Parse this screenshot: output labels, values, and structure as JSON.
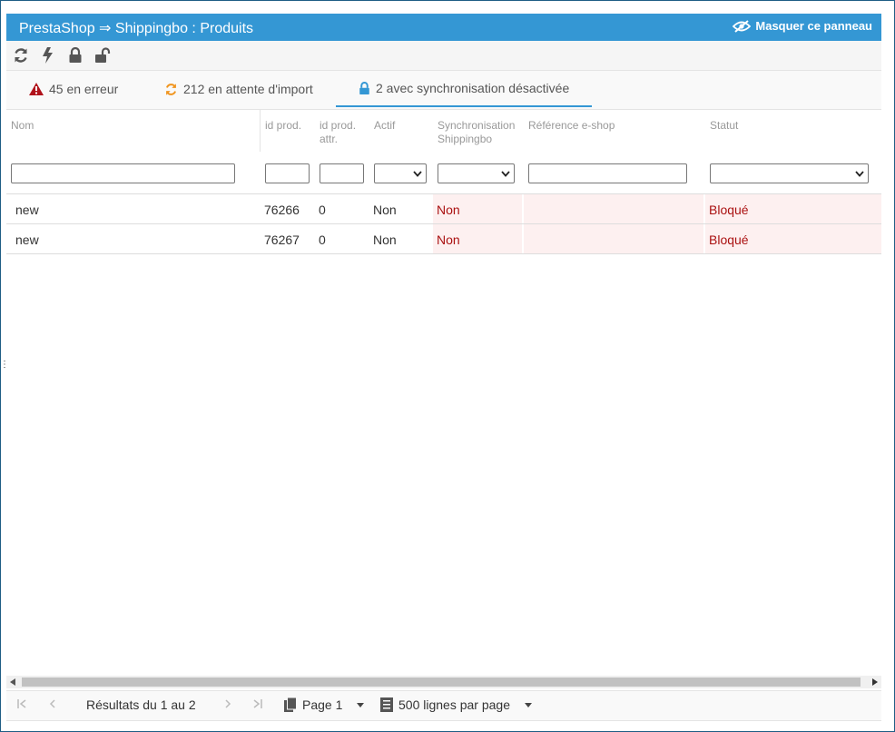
{
  "header": {
    "title": "PrestaShop ⇒ Shippingbo : Produits",
    "hide_label": "Masquer ce panneau"
  },
  "toolbar": {
    "icons": [
      "refresh-icon",
      "bolt-icon",
      "lock-icon",
      "unlock-icon"
    ]
  },
  "tabs": [
    {
      "label": "45 en erreur",
      "icon": "warning-icon",
      "color": "#b0121b"
    },
    {
      "label": "212 en attente d'import",
      "icon": "refresh-icon",
      "color": "#f0951f"
    },
    {
      "label": "2 avec synchronisation désactivée",
      "icon": "lock-icon",
      "color": "#3497d4",
      "active": true
    }
  ],
  "columns": {
    "nom": "Nom",
    "id_prod": "id prod.",
    "id_attr_1": "id prod.",
    "id_attr_2": "attr.",
    "actif": "Actif",
    "sync_1": "Synchronisation",
    "sync_2": "Shippingbo",
    "ref": "Référence e-shop",
    "statut": "Statut"
  },
  "rows": [
    {
      "nom": "new",
      "id_prod": "76266",
      "id_attr": "0",
      "actif": "Non",
      "sync": "Non",
      "ref": "",
      "statut": "Bloqué"
    },
    {
      "nom": "new",
      "id_prod": "76267",
      "id_attr": "0",
      "actif": "Non",
      "sync": "Non",
      "ref": "",
      "statut": "Bloqué"
    }
  ],
  "pager": {
    "results": "Résultats du 1 au 2",
    "page": "Page 1",
    "per_page": "500 lignes par page"
  },
  "colors": {
    "accent": "#3497d4",
    "error_text": "#a11111",
    "error_bg": "#fdf0f0"
  }
}
